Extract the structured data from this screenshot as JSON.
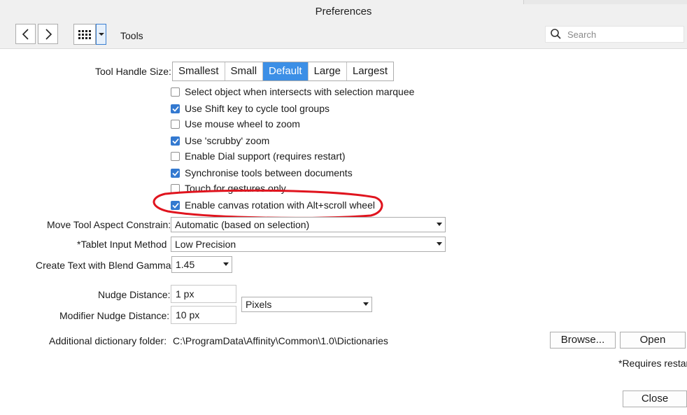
{
  "window": {
    "title": "Preferences"
  },
  "toolbar": {
    "pane_title": "Tools",
    "back_icon": "chevron-left-icon",
    "forward_icon": "chevron-right-icon",
    "grid_icon": "grid-icon",
    "search_placeholder": "Search"
  },
  "tool_handle_size": {
    "label": "Tool Handle Size:",
    "options": [
      "Smallest",
      "Small",
      "Default",
      "Large",
      "Largest"
    ],
    "selected": "Default"
  },
  "checkboxes": [
    {
      "label": "Select object when intersects with selection marquee",
      "checked": false
    },
    {
      "label": "Use Shift key to cycle tool groups",
      "checked": true
    },
    {
      "label": "Use mouse wheel to zoom",
      "checked": false
    },
    {
      "label": "Use 'scrubby' zoom",
      "checked": true
    },
    {
      "label": "Enable Dial support (requires restart)",
      "checked": false
    },
    {
      "label": "Synchronise tools between documents",
      "checked": true
    },
    {
      "label": "Touch for gestures only",
      "checked": false
    },
    {
      "label": "Enable canvas rotation with Alt+scroll wheel",
      "checked": true
    }
  ],
  "move_tool": {
    "label": "Move Tool Aspect Constrain:",
    "value": "Automatic (based on selection)"
  },
  "tablet": {
    "label": "*Tablet Input Method",
    "value": "Low Precision"
  },
  "blend_gamma": {
    "label": "Create Text with Blend Gamma:",
    "value": "1.45"
  },
  "nudge": {
    "label": "Nudge Distance:",
    "value": "1 px"
  },
  "modifier_nudge": {
    "label": "Modifier Nudge Distance:",
    "value": "10 px"
  },
  "units": {
    "value": "Pixels"
  },
  "dictionary": {
    "label": "Additional dictionary folder:",
    "path": "C:\\ProgramData\\Affinity\\Common\\1.0\\Dictionaries",
    "browse_label": "Browse...",
    "open_label": "Open"
  },
  "footer": {
    "note": "*Requires restart",
    "close_label": "Close"
  },
  "colors": {
    "accent": "#3c8fe6",
    "annotation": "#e0141e"
  }
}
